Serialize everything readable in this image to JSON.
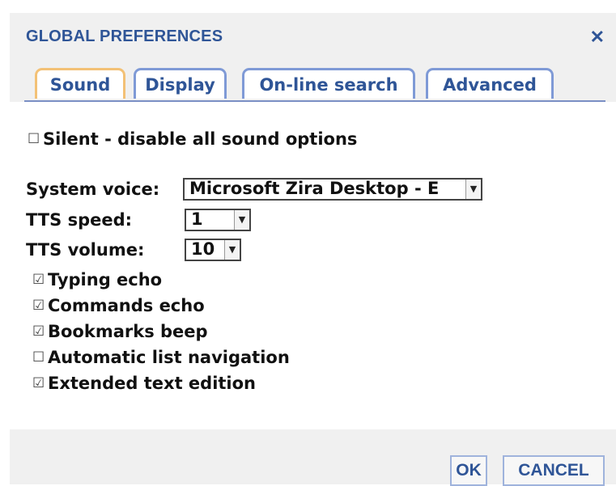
{
  "dialog": {
    "title": "GLOBAL PREFERENCES",
    "close_glyph": "✕"
  },
  "tabs": [
    {
      "label": "Sound",
      "active": true
    },
    {
      "label": "Display",
      "active": false
    },
    {
      "label": "On-line search",
      "active": false
    },
    {
      "label": "Advanced",
      "active": false
    }
  ],
  "sound": {
    "silent": {
      "label": "Silent - disable all sound options",
      "checked": false,
      "glyph": "☐"
    },
    "system_voice": {
      "label": "System voice:",
      "value": "Microsoft Zira Desktop - E"
    },
    "tts_speed": {
      "label": "TTS speed:",
      "value": "1"
    },
    "tts_volume": {
      "label": "TTS volume:",
      "value": "10"
    },
    "options": [
      {
        "label": "Typing echo",
        "checked": true,
        "glyph": "☑"
      },
      {
        "label": "Commands echo",
        "checked": true,
        "glyph": "☑"
      },
      {
        "label": "Bookmarks beep",
        "checked": true,
        "glyph": "☑"
      },
      {
        "label": "Automatic list navigation",
        "checked": false,
        "glyph": "☐"
      },
      {
        "label": "Extended text edition",
        "checked": true,
        "glyph": "☑"
      }
    ],
    "dropdown_glyph": "▼"
  },
  "buttons": {
    "ok": "OK",
    "cancel": "CANCEL"
  },
  "colors": {
    "accent": "#2f5597",
    "active_tab_border": "#f3c176",
    "tab_border": "#7f9ad6"
  }
}
